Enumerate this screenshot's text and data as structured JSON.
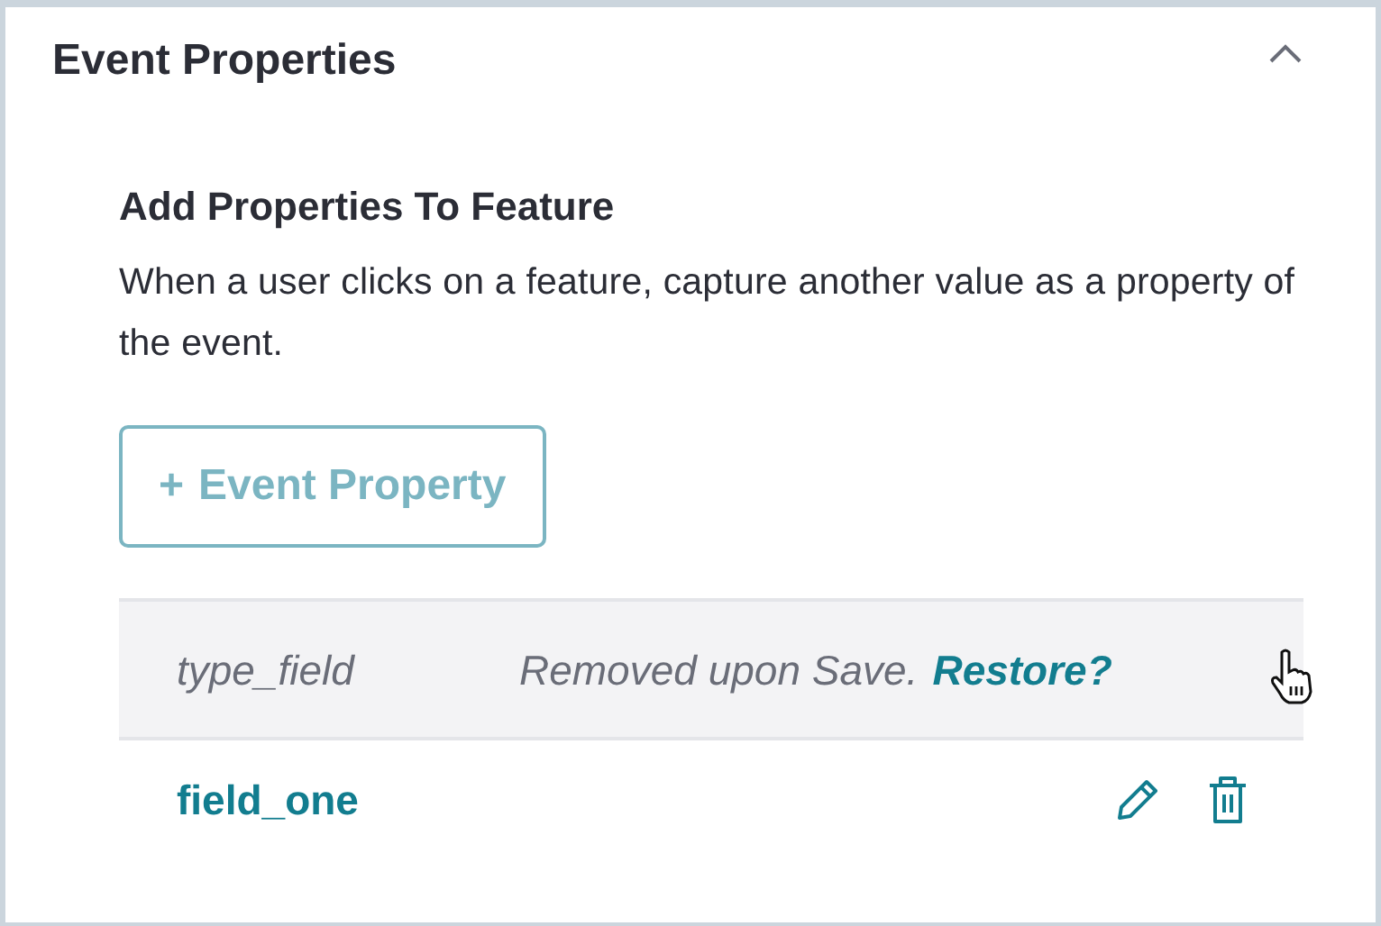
{
  "panel": {
    "title": "Event Properties",
    "expanded": true
  },
  "section": {
    "heading": "Add Properties To Feature",
    "description": "When a user clicks on a feature, capture another value as a property of the event."
  },
  "add_button": {
    "icon": "+",
    "label": "Event Property",
    "disabled": true
  },
  "properties": [
    {
      "kind": "removed",
      "name": "type_field",
      "message": "Removed upon Save.",
      "action": "Restore?"
    },
    {
      "kind": "active",
      "name": "field_one"
    }
  ]
}
